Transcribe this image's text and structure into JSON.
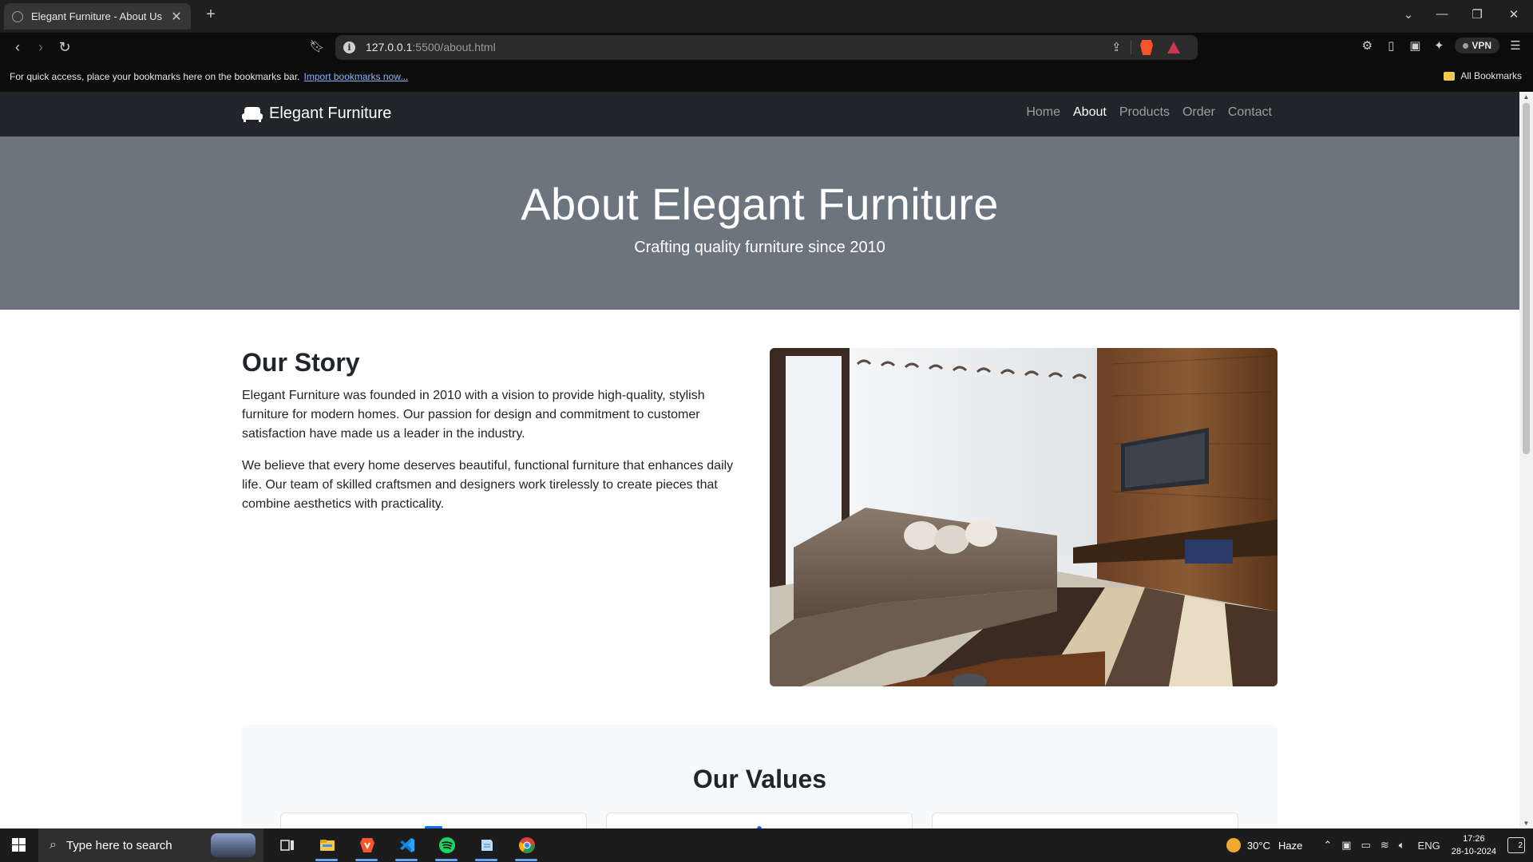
{
  "browser": {
    "tab_title": "Elegant Furniture - About Us",
    "tab_close": "✕",
    "new_tab": "+",
    "url_host": "127.0.0.1",
    "url_path": ":5500/about.html",
    "vpn_label": "VPN",
    "bookmarks_message": "For quick access, place your bookmarks here on the bookmarks bar.",
    "bookmarks_link": "Import bookmarks now...",
    "all_bookmarks": "All Bookmarks"
  },
  "site": {
    "brand": "Elegant Furniture",
    "nav": [
      "Home",
      "About",
      "Products",
      "Order",
      "Contact"
    ],
    "active_nav": "About",
    "hero_title": "About Elegant Furniture",
    "hero_subtitle": "Crafting quality furniture since 2010",
    "story_title": "Our Story",
    "story_p1": "Elegant Furniture was founded in 2010 with a vision to provide high-quality, stylish furniture for modern homes. Our passion for design and commitment to customer satisfaction have made us a leader in the industry.",
    "story_p2": "We believe that every home deserves beautiful, functional furniture that enhances daily life. Our team of skilled craftsmen and designers work tirelessly to create pieces that combine aesthetics with practicality.",
    "values_title": "Our Values"
  },
  "taskbar": {
    "search_placeholder": "Type here to search",
    "weather_temp": "30°C",
    "weather_desc": "Haze",
    "language": "ENG",
    "time": "17:26",
    "date": "28-10-2024",
    "notification_count": "2"
  },
  "colors": {
    "hero_bg": "#6c757d",
    "navbar_bg": "#212529",
    "accent": "#0d6efd"
  }
}
